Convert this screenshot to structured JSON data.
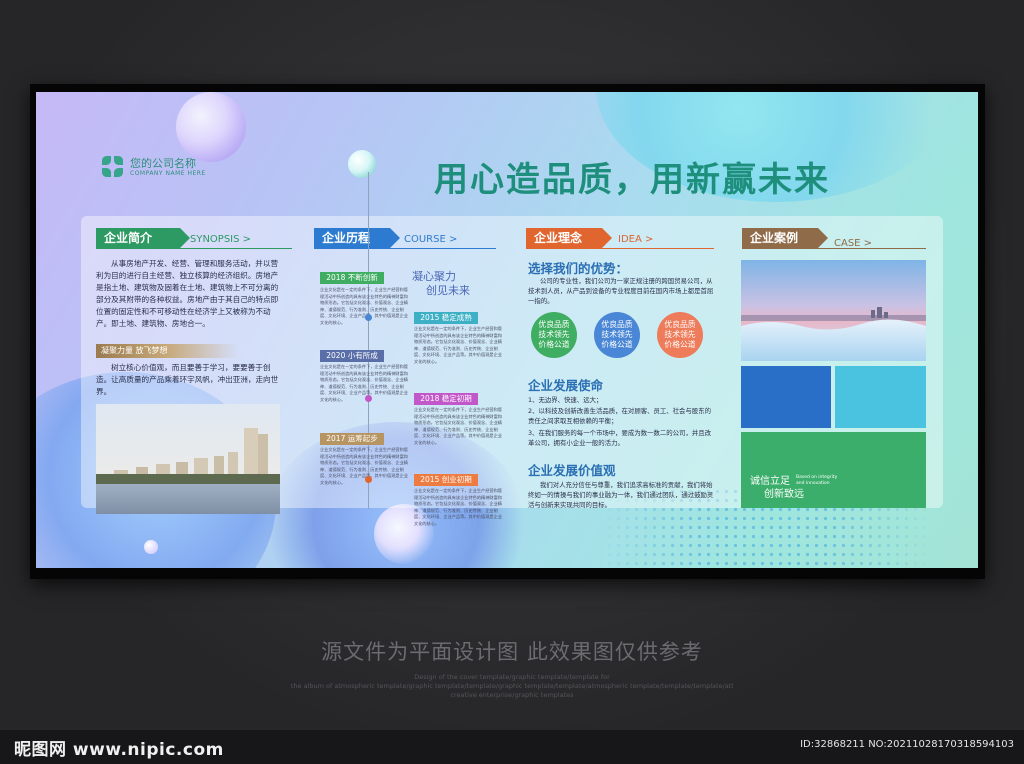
{
  "header": {
    "company_name": "您的公司名称",
    "company_en": "COMPANY NAME HERE",
    "slogan": "用心造品质，用新赢未来"
  },
  "synopsis": {
    "tag": "企业简介",
    "tag_en": "SYNOPSIS >",
    "paragraph": "从事房地产开发、经营、管理和服务活动，并以营利为目的进行自主经营、独立核算的经济组织。房地产是指土地、建筑物及固着在土地、建筑物上不可分离的部分及其附带的各种权益。房地产由于其自己的特点即位置的固定性和不可移动性在经济学上又被称为不动产。即土地、建筑物、房地合一。",
    "sub_tag": "凝聚力量 放飞梦想",
    "sub_text": "树立核心价值观，而且要善于学习，要要善于创造。让高质量的产品乘着环宇风帆，冲出亚洲，走向世界。"
  },
  "course": {
    "tag": "企业历程",
    "tag_en": "COURSE >",
    "slogan_line1": "凝心聚力",
    "slogan_line2": "创见未来",
    "entries": [
      {
        "year": "2018 不断创新",
        "text": "企业文化是在一定的条件下，企业生产经营和管理活动中所创造的具有该企业特色的精神财富和物质形态。它包括文化观念、价值观念、企业精神、道德规范、行为准则、历史传统、企业制度、文化环境、企业产品等。其中价值观是企业文化的核心。"
      },
      {
        "year": "2015 稳定成熟",
        "text": "企业文化是在一定的条件下，企业生产经营和管理活动中所创造的具有该企业特色的精神财富和物质形态。它包括文化观念、价值观念、企业精神、道德规范、行为准则、历史传统、企业制度、文化环境、企业产品等。其中价值观是企业文化的核心。"
      },
      {
        "year": "2020 小有所成",
        "text": "企业文化是在一定的条件下，企业生产经营和管理活动中所创造的具有该企业特色的精神财富和物质形态。它包括文化观念、价值观念、企业精神、道德规范、行为准则、历史传统、企业制度、文化环境、企业产品等。其中价值观是企业文化的核心。"
      },
      {
        "year": "2018 稳定初期",
        "text": "企业文化是在一定的条件下，企业生产经营和管理活动中所创造的具有该企业特色的精神财富和物质形态。它包括文化观念、价值观念、企业精神、道德规范、行为准则、历史传统、企业制度、文化环境、企业产品等。其中价值观是企业文化的核心。"
      },
      {
        "year": "2017 运筹起步",
        "text": "企业文化是在一定的条件下，企业生产经营和管理活动中所创造的具有该企业特色的精神财富和物质形态。它包括文化观念、价值观念、企业精神、道德规范、行为准则、历史传统、企业制度、文化环境、企业产品等。其中价值观是企业文化的核心。"
      },
      {
        "year": "2015 创业初期",
        "text": "企业文化是在一定的条件下，企业生产经营和管理活动中所创造的具有该企业特色的精神财富和物质形态。它包括文化观念、价值观念、企业精神、道德规范、行为准则、历史传统、企业制度、文化环境、企业产品等。其中价值观是企业文化的核心。"
      }
    ]
  },
  "idea": {
    "tag": "企业理念",
    "tag_en": "IDEA >",
    "advantage_title": "选择我们的优势：",
    "advantage_text": "公司的专业性，我们公司为一家正规注册的跨国贸易公司，从技术到人员，从产品到设备的专业程度目前在国内市场上都是首屈一指的。",
    "circles": [
      {
        "line1": "优良品质",
        "line2": "技术领先",
        "line3": "价格公道",
        "color": "#3fae62"
      },
      {
        "line1": "优良品质",
        "line2": "技术领先",
        "line3": "价格公道",
        "color": "#4a86d6"
      },
      {
        "line1": "优良品质",
        "line2": "技术领先",
        "line3": "价格公道",
        "color": "#ee7b5a"
      }
    ],
    "mission_title": "企业发展使命",
    "mission_items": [
      "1、无边界、快速、远大；",
      "2、以科技及创新改善生活品质，在对顾客、员工、社会与股东的责任之间求取互相依赖的平衡；",
      "3、在我们服务的每一个市场中，要成为数一数二的公司，并且改革公司，拥有小企业一般的活力。"
    ],
    "values_title": "企业发展价值观",
    "values_text": "我们对人充分信任与尊重，我们追求高标准的贡献，我们将始终如一的情操与我们的事业融为一体，我们通过团队，通过鼓励灵活与创新来实现共同的目标。"
  },
  "case": {
    "tag": "企业案例",
    "tag_en": "CASE >",
    "motto_line1": "诚信立足",
    "motto_line2": "创新致远",
    "motto_en": "Based on integrity and innovation"
  },
  "notice": {
    "main": "源文件为平面设计图 此效果图仅供参考",
    "fine_1": "Design of the cover template/graphic template/template for",
    "fine_2": "the album of atmospheric template/graphic template/template/graphic template/template/atmospheric template/template/template/atl",
    "fine_3": "creative enterprise/graphic templates"
  },
  "footer": {
    "brand": "昵图网 www.nipic.com",
    "image_id": "ID:32868211 NO:20211028170318594103"
  },
  "colors": {
    "green": "#1f8f7d",
    "tag_green": "#2e9a63",
    "tag_blue": "#2d7bd0",
    "tag_orange": "#e0652f",
    "tag_brown": "#8f6b4a"
  }
}
